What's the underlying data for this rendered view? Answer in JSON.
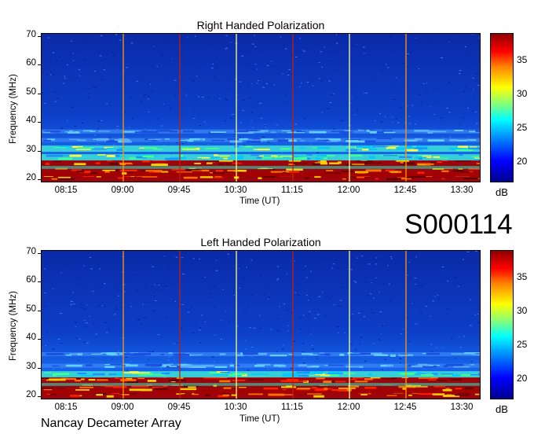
{
  "chart_data": [
    {
      "type": "heatmap",
      "title": "Right Handed Polarization",
      "xlabel": "Time (UT)",
      "ylabel": "Frequency (MHz)",
      "xticks": [
        "08:15",
        "09:00",
        "09:45",
        "10:30",
        "11:15",
        "12:00",
        "12:45",
        "13:30"
      ],
      "yticks": [
        "20",
        "30",
        "40",
        "50",
        "60",
        "70"
      ],
      "ylim": [
        19,
        71
      ],
      "colorbar": {
        "label": "dB",
        "ticks": [
          "20",
          "25",
          "30",
          "35"
        ],
        "range": [
          17,
          39
        ]
      },
      "vertical_lines_time": [
        "09:00",
        "09:45",
        "10:30",
        "11:15",
        "12:00",
        "12:45"
      ],
      "bands_mhz": [
        {
          "center": 21,
          "level": "high"
        },
        {
          "center": 23,
          "level": "high"
        },
        {
          "center": 26,
          "level": "high"
        },
        {
          "center": 28,
          "level": "medium"
        },
        {
          "center": 31,
          "level": "medium"
        },
        {
          "center": 34,
          "level": "low"
        },
        {
          "center": 37,
          "level": "low"
        }
      ]
    },
    {
      "type": "heatmap",
      "title": "Left Handed Polarization",
      "xlabel": "Time (UT)",
      "ylabel": "Frequency (MHz)",
      "xticks": [
        "08:15",
        "09:00",
        "09:45",
        "10:30",
        "11:15",
        "12:00",
        "12:45",
        "13:30"
      ],
      "yticks": [
        "20",
        "30",
        "40",
        "50",
        "60",
        "70"
      ],
      "ylim": [
        19,
        71
      ],
      "colorbar": {
        "label": "dB",
        "ticks": [
          "20",
          "25",
          "30",
          "35"
        ],
        "range": [
          17,
          39
        ]
      },
      "vertical_lines_time": [
        "09:00",
        "09:45",
        "10:30",
        "11:15",
        "12:00",
        "12:45"
      ],
      "bands_mhz": [
        {
          "center": 21,
          "level": "high"
        },
        {
          "center": 23,
          "level": "high"
        },
        {
          "center": 26,
          "level": "high"
        },
        {
          "center": 28,
          "level": "medium"
        },
        {
          "center": 31,
          "level": "low"
        },
        {
          "center": 35,
          "level": "low"
        }
      ]
    }
  ],
  "observation_id": "S000114",
  "footer": "Nancay Decameter Array",
  "colors": {
    "background": "#0a36b8",
    "low": "#2a6cf0",
    "medium": "#3ad0e0",
    "high": "#a00000",
    "line_orange": "#ff9a00",
    "line_red": "#d02000",
    "line_yellow": "#ffff60"
  }
}
